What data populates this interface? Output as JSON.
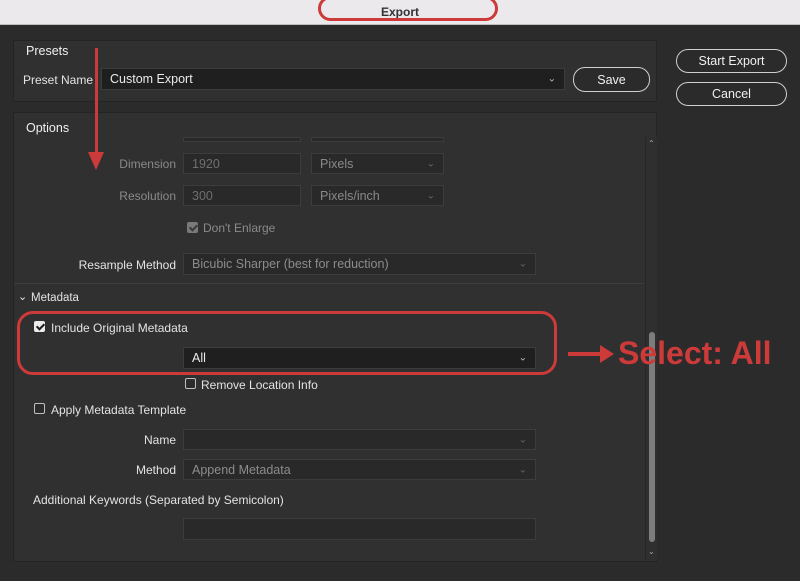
{
  "window": {
    "title": "Export"
  },
  "presets": {
    "section_label": "Presets",
    "preset_name_label": "Preset Name",
    "preset_name_value": "Custom Export",
    "save_label": "Save"
  },
  "actions": {
    "start_export": "Start Export",
    "cancel": "Cancel"
  },
  "options": {
    "section_label": "Options",
    "dimension_label": "Dimension",
    "dimension_value": "1920",
    "dimension_unit": "Pixels",
    "resolution_label": "Resolution",
    "resolution_value": "300",
    "resolution_unit": "Pixels/inch",
    "dont_enlarge_label": "Don't Enlarge",
    "dont_enlarge_checked": true,
    "resample_label": "Resample Method",
    "resample_value": "Bicubic Sharper (best for reduction)"
  },
  "metadata": {
    "section_label": "Metadata",
    "include_original_label": "Include Original Metadata",
    "include_original_checked": true,
    "include_original_value": "All",
    "remove_location_label": "Remove Location Info",
    "remove_location_checked": false,
    "apply_template_label": "Apply Metadata Template",
    "apply_template_checked": false,
    "name_label": "Name",
    "name_value": "",
    "method_label": "Method",
    "method_value": "Append Metadata",
    "keywords_label": "Additional Keywords (Separated by Semicolon)",
    "keywords_value": ""
  },
  "annotation": {
    "text": "Select: All",
    "color": "#cc3a3a"
  }
}
